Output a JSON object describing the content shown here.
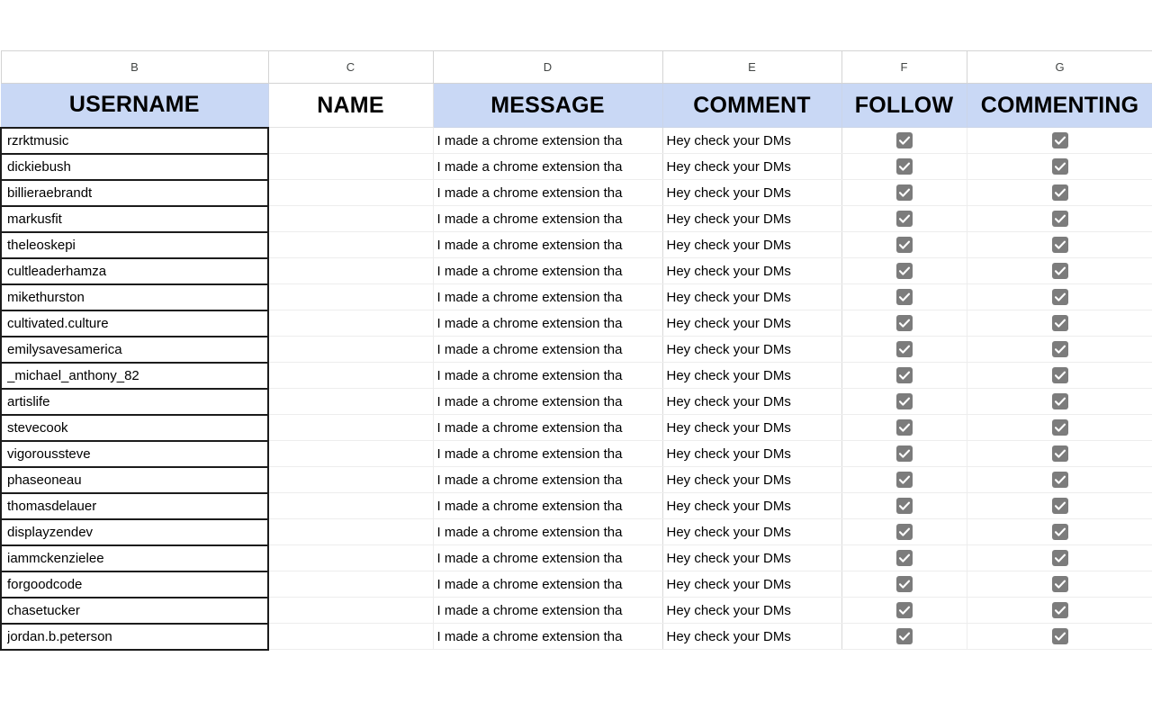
{
  "spreadsheet": {
    "column_letters": [
      "B",
      "C",
      "D",
      "E",
      "F",
      "G"
    ],
    "headers": [
      {
        "letter": "B",
        "label": "USERNAME",
        "highlighted": true
      },
      {
        "letter": "C",
        "label": "NAME",
        "highlighted": false
      },
      {
        "letter": "D",
        "label": "MESSAGE",
        "highlighted": true
      },
      {
        "letter": "E",
        "label": "COMMENT",
        "highlighted": true
      },
      {
        "letter": "F",
        "label": "FOLLOW",
        "highlighted": true
      },
      {
        "letter": "G",
        "label": "COMMENTING",
        "highlighted": true
      }
    ],
    "header_fill_color": "#c9d8f5",
    "checkbox_color": "#7c7c7c",
    "message_text": "I made a chrome extension tha",
    "comment_text": "Hey check your DMs",
    "checkbox_icon": "checkmark-icon",
    "rows": [
      {
        "username": "rzrktmusic",
        "name": "",
        "message": "I made a chrome extension tha",
        "comment": "Hey check your DMs",
        "follow": true,
        "commenting": true
      },
      {
        "username": "dickiebush",
        "name": "",
        "message": "I made a chrome extension tha",
        "comment": "Hey check your DMs",
        "follow": true,
        "commenting": true
      },
      {
        "username": "billieraebrandt",
        "name": "",
        "message": "I made a chrome extension tha",
        "comment": "Hey check your DMs",
        "follow": true,
        "commenting": true
      },
      {
        "username": "markusfit",
        "name": "",
        "message": "I made a chrome extension tha",
        "comment": "Hey check your DMs",
        "follow": true,
        "commenting": true
      },
      {
        "username": "theleoskepi",
        "name": "",
        "message": "I made a chrome extension tha",
        "comment": "Hey check your DMs",
        "follow": true,
        "commenting": true
      },
      {
        "username": "cultleaderhamza",
        "name": "",
        "message": "I made a chrome extension tha",
        "comment": "Hey check your DMs",
        "follow": true,
        "commenting": true
      },
      {
        "username": "mikethurston",
        "name": "",
        "message": "I made a chrome extension tha",
        "comment": "Hey check your DMs",
        "follow": true,
        "commenting": true
      },
      {
        "username": "cultivated.culture",
        "name": "",
        "message": "I made a chrome extension tha",
        "comment": "Hey check your DMs",
        "follow": true,
        "commenting": true
      },
      {
        "username": "emilysavesamerica",
        "name": "",
        "message": "I made a chrome extension tha",
        "comment": "Hey check your DMs",
        "follow": true,
        "commenting": true
      },
      {
        "username": "_michael_anthony_82",
        "name": "",
        "message": "I made a chrome extension tha",
        "comment": "Hey check your DMs",
        "follow": true,
        "commenting": true
      },
      {
        "username": "artislife",
        "name": "",
        "message": "I made a chrome extension tha",
        "comment": "Hey check your DMs",
        "follow": true,
        "commenting": true
      },
      {
        "username": "stevecook",
        "name": "",
        "message": "I made a chrome extension tha",
        "comment": "Hey check your DMs",
        "follow": true,
        "commenting": true
      },
      {
        "username": "vigoroussteve",
        "name": "",
        "message": "I made a chrome extension tha",
        "comment": "Hey check your DMs",
        "follow": true,
        "commenting": true
      },
      {
        "username": "phaseoneau",
        "name": "",
        "message": "I made a chrome extension tha",
        "comment": "Hey check your DMs",
        "follow": true,
        "commenting": true
      },
      {
        "username": "thomasdelauer",
        "name": "",
        "message": "I made a chrome extension tha",
        "comment": "Hey check your DMs",
        "follow": true,
        "commenting": true
      },
      {
        "username": "displayzendev",
        "name": "",
        "message": "I made a chrome extension tha",
        "comment": "Hey check your DMs",
        "follow": true,
        "commenting": true
      },
      {
        "username": "iammckenzielee",
        "name": "",
        "message": "I made a chrome extension tha",
        "comment": "Hey check your DMs",
        "follow": true,
        "commenting": true
      },
      {
        "username": "forgoodcode",
        "name": "",
        "message": "I made a chrome extension tha",
        "comment": "Hey check your DMs",
        "follow": true,
        "commenting": true
      },
      {
        "username": "chasetucker",
        "name": "",
        "message": "I made a chrome extension tha",
        "comment": "Hey check your DMs",
        "follow": true,
        "commenting": true
      },
      {
        "username": "jordan.b.peterson",
        "name": "",
        "message": "I made a chrome extension tha",
        "comment": "Hey check your DMs",
        "follow": true,
        "commenting": true
      }
    ]
  }
}
